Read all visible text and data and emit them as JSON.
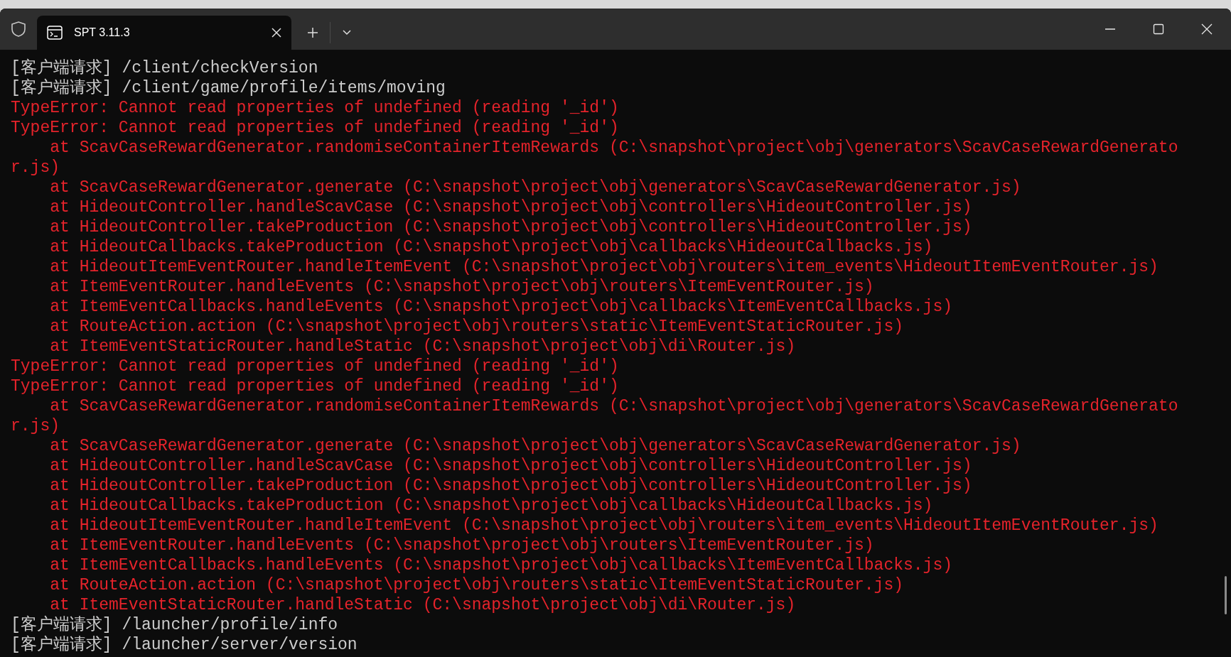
{
  "window": {
    "tab": {
      "title": "SPT 3.11.3",
      "selected": true
    }
  },
  "lines": [
    {
      "kind": "info",
      "text": "[客户端请求] /client/checkVersion"
    },
    {
      "kind": "info",
      "text": "[客户端请求] /client/game/profile/items/moving"
    },
    {
      "kind": "error",
      "text": "TypeError: Cannot read properties of undefined (reading '_id')"
    },
    {
      "kind": "error",
      "text": "TypeError: Cannot read properties of undefined (reading '_id')"
    },
    {
      "kind": "error",
      "text": "    at ScavCaseRewardGenerator.randomiseContainerItemRewards (C:\\snapshot\\project\\obj\\generators\\ScavCaseRewardGenerator.js)"
    },
    {
      "kind": "error",
      "text": "    at ScavCaseRewardGenerator.generate (C:\\snapshot\\project\\obj\\generators\\ScavCaseRewardGenerator.js)"
    },
    {
      "kind": "error",
      "text": "    at HideoutController.handleScavCase (C:\\snapshot\\project\\obj\\controllers\\HideoutController.js)"
    },
    {
      "kind": "error",
      "text": "    at HideoutController.takeProduction (C:\\snapshot\\project\\obj\\controllers\\HideoutController.js)"
    },
    {
      "kind": "error",
      "text": "    at HideoutCallbacks.takeProduction (C:\\snapshot\\project\\obj\\callbacks\\HideoutCallbacks.js)"
    },
    {
      "kind": "error",
      "text": "    at HideoutItemEventRouter.handleItemEvent (C:\\snapshot\\project\\obj\\routers\\item_events\\HideoutItemEventRouter.js)"
    },
    {
      "kind": "error",
      "text": "    at ItemEventRouter.handleEvents (C:\\snapshot\\project\\obj\\routers\\ItemEventRouter.js)"
    },
    {
      "kind": "error",
      "text": "    at ItemEventCallbacks.handleEvents (C:\\snapshot\\project\\obj\\callbacks\\ItemEventCallbacks.js)"
    },
    {
      "kind": "error",
      "text": "    at RouteAction.action (C:\\snapshot\\project\\obj\\routers\\static\\ItemEventStaticRouter.js)"
    },
    {
      "kind": "error",
      "text": "    at ItemEventStaticRouter.handleStatic (C:\\snapshot\\project\\obj\\di\\Router.js)"
    },
    {
      "kind": "error",
      "text": "TypeError: Cannot read properties of undefined (reading '_id')"
    },
    {
      "kind": "error",
      "text": "TypeError: Cannot read properties of undefined (reading '_id')"
    },
    {
      "kind": "error",
      "text": "    at ScavCaseRewardGenerator.randomiseContainerItemRewards (C:\\snapshot\\project\\obj\\generators\\ScavCaseRewardGenerator.js)"
    },
    {
      "kind": "error",
      "text": "    at ScavCaseRewardGenerator.generate (C:\\snapshot\\project\\obj\\generators\\ScavCaseRewardGenerator.js)"
    },
    {
      "kind": "error",
      "text": "    at HideoutController.handleScavCase (C:\\snapshot\\project\\obj\\controllers\\HideoutController.js)"
    },
    {
      "kind": "error",
      "text": "    at HideoutController.takeProduction (C:\\snapshot\\project\\obj\\controllers\\HideoutController.js)"
    },
    {
      "kind": "error",
      "text": "    at HideoutCallbacks.takeProduction (C:\\snapshot\\project\\obj\\callbacks\\HideoutCallbacks.js)"
    },
    {
      "kind": "error",
      "text": "    at HideoutItemEventRouter.handleItemEvent (C:\\snapshot\\project\\obj\\routers\\item_events\\HideoutItemEventRouter.js)"
    },
    {
      "kind": "error",
      "text": "    at ItemEventRouter.handleEvents (C:\\snapshot\\project\\obj\\routers\\ItemEventRouter.js)"
    },
    {
      "kind": "error",
      "text": "    at ItemEventCallbacks.handleEvents (C:\\snapshot\\project\\obj\\callbacks\\ItemEventCallbacks.js)"
    },
    {
      "kind": "error",
      "text": "    at RouteAction.action (C:\\snapshot\\project\\obj\\routers\\static\\ItemEventStaticRouter.js)"
    },
    {
      "kind": "error",
      "text": "    at ItemEventStaticRouter.handleStatic (C:\\snapshot\\project\\obj\\di\\Router.js)"
    },
    {
      "kind": "info",
      "text": "[客户端请求] /launcher/profile/info"
    },
    {
      "kind": "info",
      "text": "[客户端请求] /launcher/server/version"
    }
  ]
}
